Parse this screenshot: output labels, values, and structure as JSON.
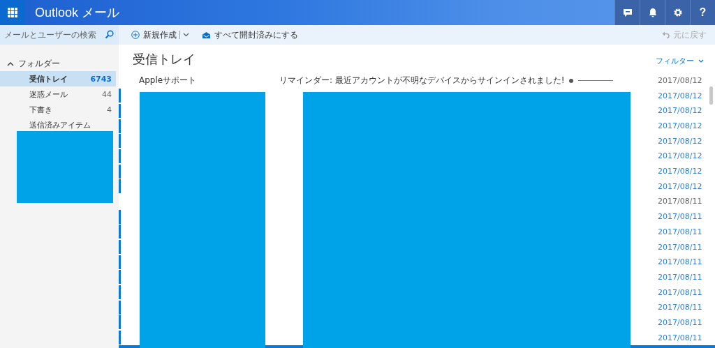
{
  "app_bar": {
    "title": "Outlook メール",
    "help": "?"
  },
  "search": {
    "placeholder": "メールとユーザーの検索"
  },
  "toolbar": {
    "new_label": "新規作成",
    "mark_all_read": "すべて開封済みにする",
    "undo": "元に戻す",
    "undo_disabled": true
  },
  "folders": {
    "header": "フォルダー",
    "expanded": true,
    "items": [
      {
        "name": "受信トレイ",
        "count": "6743",
        "selected": true
      },
      {
        "name": "迷惑メール",
        "count": "44",
        "selected": false
      },
      {
        "name": "下書き",
        "count": "4",
        "selected": false
      },
      {
        "name": "送信済みアイテム",
        "selected": false
      }
    ]
  },
  "list": {
    "title": "受信トレイ",
    "filter": "フィルター",
    "rows": [
      {
        "sender": "Appleサポート",
        "subject": "リマインダー: 最近アカウントが不明なデバイスからサインインされました!",
        "marker": "●",
        "date": "2017/08/12",
        "unread": false
      },
      {
        "date": "2017/08/12",
        "unread": true
      },
      {
        "date": "2017/08/12",
        "unread": true
      },
      {
        "date": "2017/08/12",
        "unread": true
      },
      {
        "date": "2017/08/12",
        "unread": true
      },
      {
        "date": "2017/08/12",
        "unread": true
      },
      {
        "date": "2017/08/12",
        "unread": true
      },
      {
        "date": "2017/08/12",
        "unread": true
      },
      {
        "date": "2017/08/11",
        "unread": false
      },
      {
        "date": "2017/08/11",
        "unread": true
      },
      {
        "date": "2017/08/11",
        "unread": true
      },
      {
        "date": "2017/08/11",
        "unread": true
      },
      {
        "date": "2017/08/11",
        "unread": true
      },
      {
        "date": "2017/08/11",
        "unread": true
      },
      {
        "date": "2017/08/11",
        "unread": true
      },
      {
        "date": "2017/08/11",
        "unread": true
      },
      {
        "date": "2017/08/11",
        "unread": true
      },
      {
        "date": "2017/08/11",
        "unread": true
      }
    ]
  }
}
